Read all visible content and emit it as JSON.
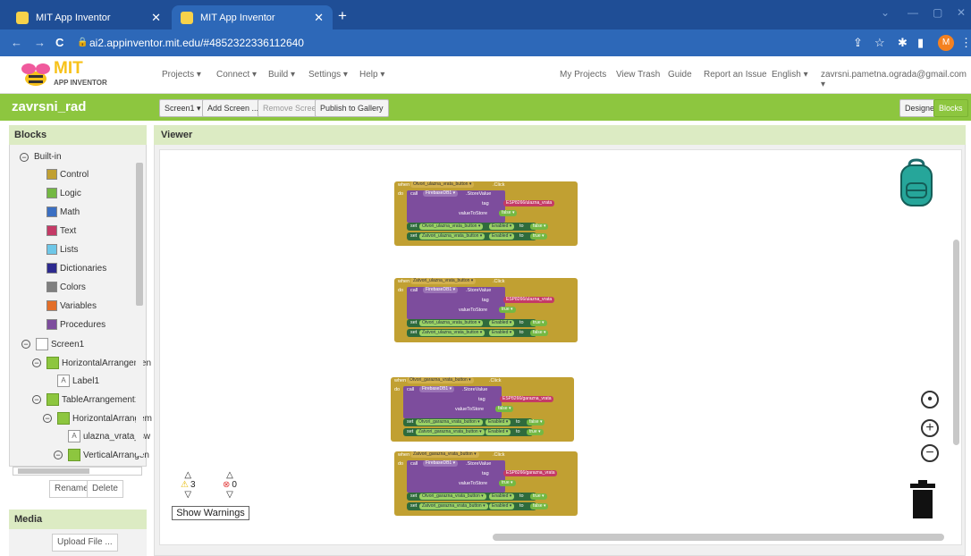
{
  "browser": {
    "tabs": [
      {
        "title": "MIT App Inventor"
      },
      {
        "title": "MIT App Inventor"
      }
    ],
    "url": "ai2.appinventor.mit.edu/#4852322336112640",
    "profile_initial": "M"
  },
  "app_header": {
    "logo_mit": "MIT",
    "logo_sub": "APP INVENTOR",
    "menus": [
      "Projects ▾",
      "Connect ▾",
      "Build ▾",
      "Settings ▾",
      "Help ▾"
    ],
    "links": [
      "My Projects",
      "View Trash",
      "Guide",
      "Report an Issue",
      "English ▾",
      "zavrsni.pametna.ograda@gmail.com ▾"
    ]
  },
  "project": {
    "name": "zavrsni_rad",
    "screen_select": "Screen1 ▾",
    "add_screen": "Add Screen ...",
    "remove_screen": "Remove Screen",
    "publish": "Publish to Gallery",
    "designer": "Designer",
    "blocks": "Blocks"
  },
  "blocks_panel": {
    "title": "Blocks",
    "builtin_label": "Built-in",
    "builtin": [
      {
        "label": "Control",
        "color": "#c1a032"
      },
      {
        "label": "Logic",
        "color": "#74b843"
      },
      {
        "label": "Math",
        "color": "#3b6fc2"
      },
      {
        "label": "Text",
        "color": "#c43a66"
      },
      {
        "label": "Lists",
        "color": "#6ec7e8"
      },
      {
        "label": "Dictionaries",
        "color": "#2d2a8f"
      },
      {
        "label": "Colors",
        "color": "#7f7f7f"
      },
      {
        "label": "Variables",
        "color": "#e36f2a"
      },
      {
        "label": "Procedures",
        "color": "#7d4d9d"
      }
    ],
    "components": [
      {
        "label": "Screen1"
      },
      {
        "label": "HorizontalArrangemen"
      },
      {
        "label": "Label1"
      },
      {
        "label": "TableArrangement1"
      },
      {
        "label": "HorizontalArrangem"
      },
      {
        "label": "ulazna_vrata_sw"
      },
      {
        "label": "VerticalArrangen"
      }
    ],
    "rename": "Rename",
    "delete": "Delete"
  },
  "media": {
    "title": "Media",
    "upload": "Upload File ..."
  },
  "viewer": {
    "title": "Viewer",
    "warnings_count": "3",
    "errors_count": "0",
    "show_warnings": "Show Warnings"
  },
  "block_groups": [
    {
      "event_button": "Otvori_ulazna_vrata_button ▾",
      "tag": "ESP8266/ulazna_vrata",
      "value": "false ▾",
      "set1": "Otvori_ulazna_vrata_button ▾",
      "set1_val": "false ▾",
      "set2": "Zatvori_ulazna_vrata_button ▾",
      "set2_val": "true ▾"
    },
    {
      "event_button": "Zatvori_ulazna_vrata_button ▾",
      "tag": "ESP8266/ulazna_vrata",
      "value": "true ▾",
      "set1": "Otvori_ulazna_vrata_button ▾",
      "set1_val": "true ▾",
      "set2": "Zatvori_ulazna_vrata_button ▾",
      "set2_val": "false ▾"
    },
    {
      "event_button": "Otvori_garazna_vrata_button ▾",
      "tag": "ESP8266/garazna_vrata",
      "value": "false ▾",
      "set1": "Otvori_garazna_vrata_button ▾",
      "set1_val": "false ▾",
      "set2": "Zatvori_garazna_vrata_button ▾",
      "set2_val": "true ▾"
    },
    {
      "event_button": "Zatvori_garazna_vrata_button ▾",
      "tag": "ESP8266/garazna_vrata",
      "value": "true ▾",
      "set1": "Otvori_garazna_vrata_button ▾",
      "set1_val": "true ▾",
      "set2": "Zatvori_garazna_vrata_button ▾",
      "set2_val": "false ▾"
    }
  ],
  "block_text": {
    "when": "when",
    "click": ".Click",
    "do": "do",
    "call": "call",
    "db": "FirebaseDB1 ▾",
    "store": ".StoreValue",
    "tag_label": "tag",
    "value_label": "valueToStore",
    "set": "set",
    "enabled": "Enabled ▾",
    "to": "to"
  }
}
